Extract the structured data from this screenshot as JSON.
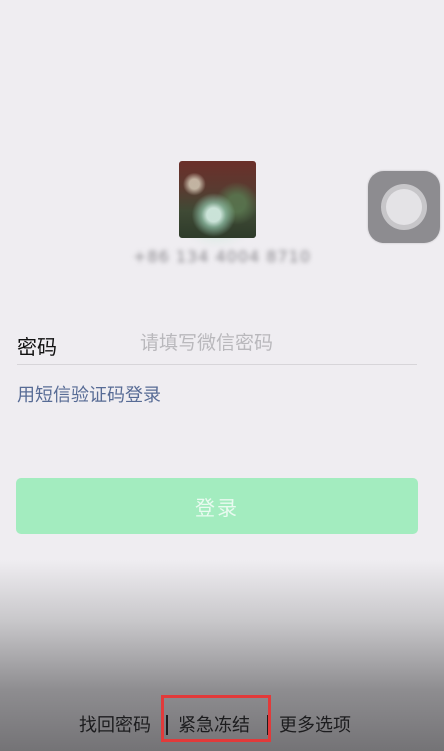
{
  "account": {
    "phone": "+86 134 4004 8710"
  },
  "login": {
    "password_label": "密码",
    "password_placeholder": "请填写微信密码",
    "sms_link": "用短信验证码登录",
    "login_button": "登录"
  },
  "bottom_links": {
    "find_password": "找回密码",
    "emergency_freeze": "紧急冻结",
    "more_options": "更多选项"
  },
  "colors": {
    "accent_green": "#a3ecbf",
    "link_blue": "#576b95",
    "highlight_red": "#e23a3a"
  }
}
